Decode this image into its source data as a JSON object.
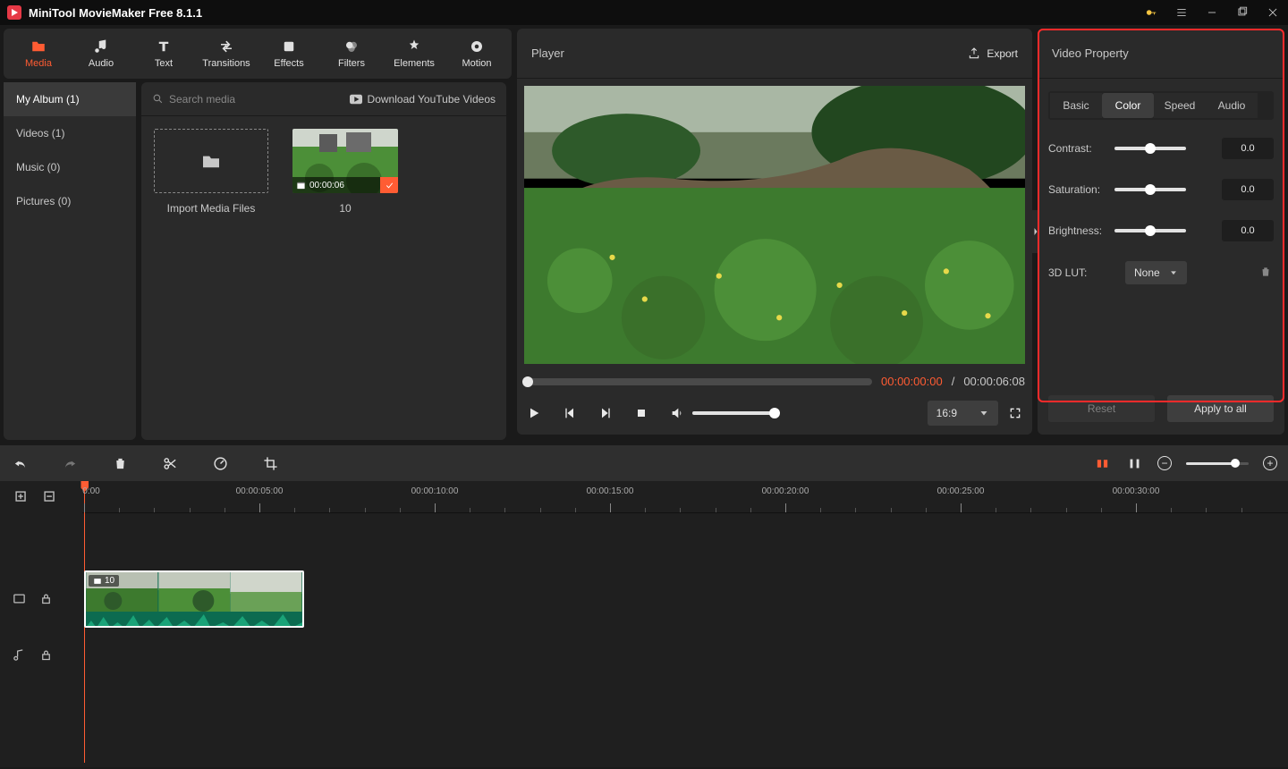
{
  "app": {
    "title": "MiniTool MovieMaker Free 8.1.1"
  },
  "tabs": {
    "media": "Media",
    "audio": "Audio",
    "text": "Text",
    "transitions": "Transitions",
    "effects": "Effects",
    "filters": "Filters",
    "elements": "Elements",
    "motion": "Motion"
  },
  "sidebar": {
    "album": "My Album (1)",
    "videos": "Videos (1)",
    "music": "Music (0)",
    "pictures": "Pictures (0)"
  },
  "media": {
    "search": "Search media",
    "youtube": "Download YouTube Videos",
    "import": "Import Media Files",
    "clipName": "10",
    "clipDur": "00:00:06"
  },
  "player": {
    "title": "Player",
    "export": "Export",
    "cur": "00:00:00:00",
    "sep": " / ",
    "total": "00:00:06:08",
    "aspect": "16:9"
  },
  "prop": {
    "title": "Video Property",
    "tabs": {
      "basic": "Basic",
      "color": "Color",
      "speed": "Speed",
      "audio": "Audio"
    },
    "contrast": {
      "label": "Contrast:",
      "val": "0.0"
    },
    "saturation": {
      "label": "Saturation:",
      "val": "0.0"
    },
    "brightness": {
      "label": "Brightness:",
      "val": "0.0"
    },
    "lut": {
      "label": "3D LUT:",
      "val": "None"
    },
    "reset": "Reset",
    "apply": "Apply to all"
  },
  "ruler": {
    "t0": "0:00",
    "t1": "00:00:05:00",
    "t2": "00:00:10:00",
    "t3": "00:00:15:00",
    "t4": "00:00:20:00",
    "t5": "00:00:25:00",
    "t6": "00:00:30:00"
  },
  "clip": {
    "label": "10"
  }
}
